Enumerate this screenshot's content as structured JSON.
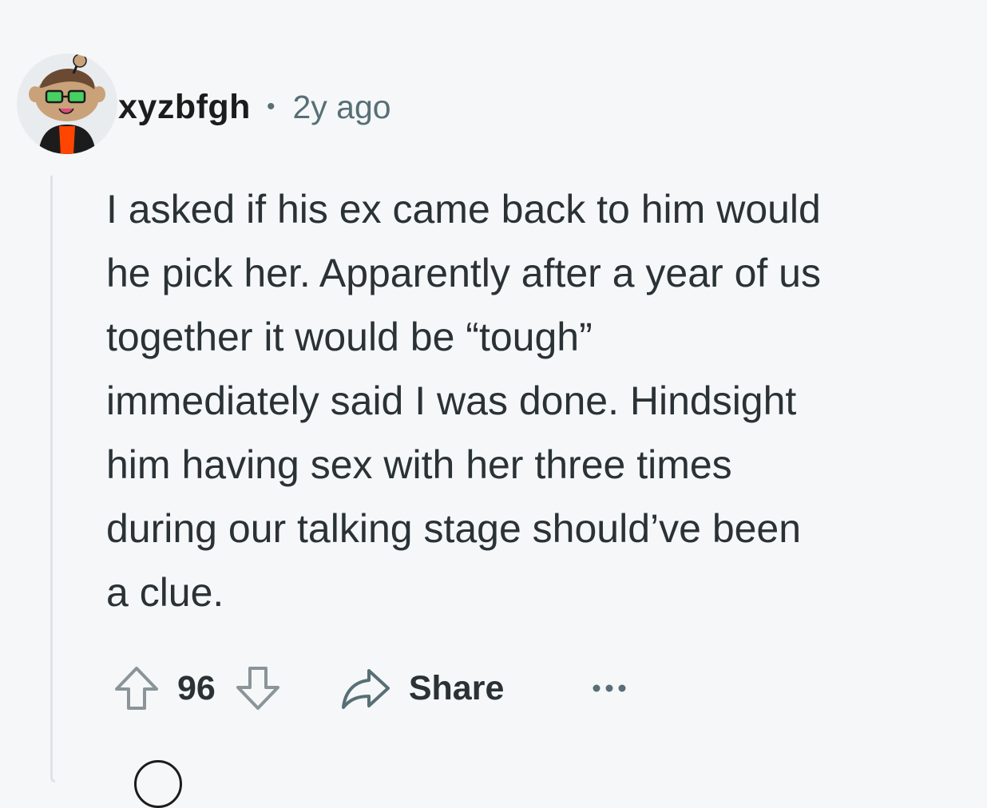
{
  "comment": {
    "author": "xyzbfgh",
    "separator": "•",
    "timestamp": "2y ago",
    "body_lines": [
      "I asked if his ex came back to him would",
      "he pick her. Apparently after a year of us",
      "together it would be “tough”",
      "immediately said I was done. Hindsight",
      "him having sex with her three times",
      "during our talking stage should’ve been",
      "a clue."
    ],
    "actions": {
      "vote_count": "96",
      "share_label": "Share"
    }
  },
  "icons": {
    "avatar": "snoo-avatar-icon",
    "upvote": "arrow-up-icon",
    "downvote": "arrow-down-icon",
    "share": "share-arrow-icon",
    "more": "more-dots-icon"
  },
  "colors": {
    "background": "#f6f7f8",
    "text": "#2a3236",
    "muted": "#576f76",
    "thread_line": "#dfe3e6",
    "icon_stroke": "#8a9499",
    "avatar_shirt": "#ff4500",
    "avatar_glasses": "#46d160"
  }
}
